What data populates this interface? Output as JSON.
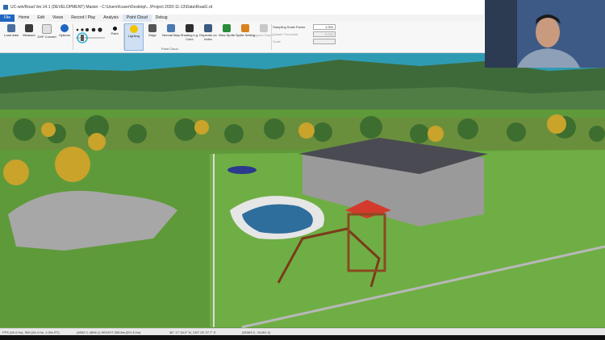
{
  "window": {
    "title": "UC-win/Road Ver.14.1 (DEVELOPMENT) Master - C:\\Users\\fcuser\\Desktop\\...\\Project 2020-11-13\\Data\\Road1.rd"
  },
  "menu": {
    "items": [
      "File",
      "Home",
      "Edit",
      "Views",
      "Record / Play",
      "Analysis",
      "Point Cloud",
      "Debug"
    ]
  },
  "ribbon": {
    "buttons": {
      "load": "Load data",
      "measure": "Measure",
      "dxf": "DXF Convert",
      "options": "Options",
      "point": "Point",
      "lighting": "Lighting",
      "edge": "Edge",
      "normal_map": "Normal Map",
      "shading": "Shading e.g. Color",
      "depends": "Depends on Index",
      "view_sprite": "View Sprite",
      "sprite_setting": "Sprite Setting",
      "ignore_depth": "Ignore Depth"
    },
    "sampling": {
      "label": "Sampling Scale Factor",
      "value": "1.000"
    },
    "distance": {
      "label": "Distant Threshold",
      "value": "0.020"
    },
    "scale": {
      "label": "Scale",
      "value": ""
    },
    "group_label": "Point Cloud"
  },
  "status": {
    "fps": "FPS (26.4 Hz), SIM (26.4 Hz, 1.00x RT)",
    "coords": "(4892.3, 4896.1) HEIGHT 555.8m (EH 3.0m)",
    "geo": "36° 17' 54.0\" N, 139° 25' 27.7\" E",
    "extra": "(55363.0, -51451.0)"
  },
  "colors": {
    "accent": "#1f66c1",
    "sky": "#2f9bb3",
    "grass": "#5f9a3a"
  }
}
